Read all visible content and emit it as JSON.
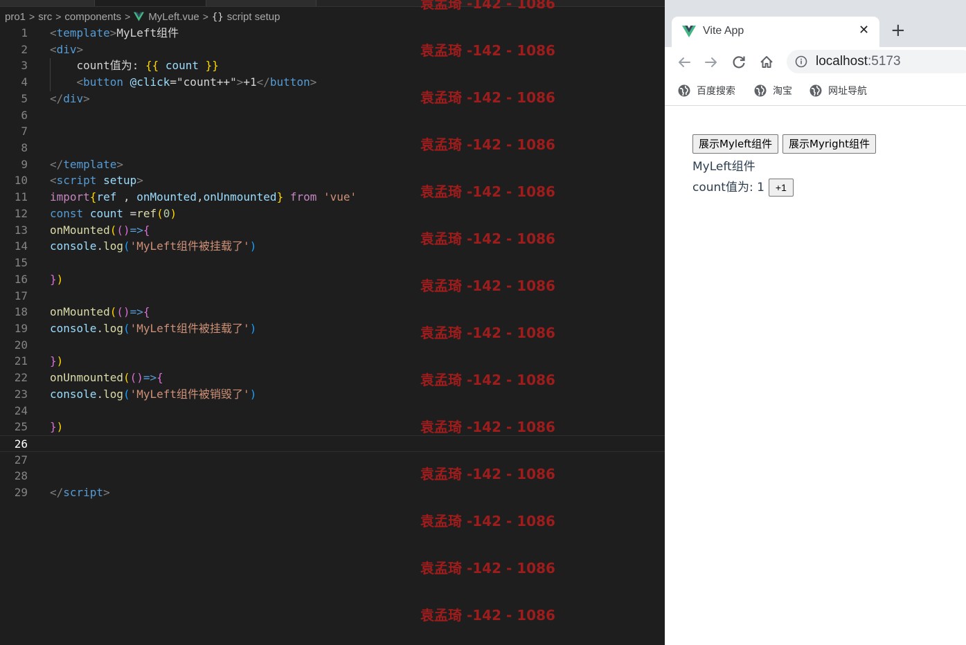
{
  "editor": {
    "breadcrumb": {
      "folder1": "pro1",
      "folder2": "src",
      "folder3": "components",
      "file": "MyLeft.vue",
      "symbol": "script setup"
    },
    "current_line": 26,
    "lines": [
      {
        "n": "1",
        "tokens": [
          [
            "t-punc",
            "<"
          ],
          [
            "t-tag",
            "template"
          ],
          [
            "t-punc",
            ">"
          ],
          [
            "t-text",
            "MyLeft组件"
          ]
        ]
      },
      {
        "n": "2",
        "tokens": [
          [
            "t-punc",
            "<"
          ],
          [
            "t-tag",
            "div"
          ],
          [
            "t-punc",
            ">"
          ]
        ]
      },
      {
        "n": "3",
        "tokens": [
          [
            "t-text",
            "    count值为: "
          ],
          [
            "t-br1",
            "{{"
          ],
          [
            "t-var",
            " count "
          ],
          [
            "t-br1",
            "}}"
          ]
        ]
      },
      {
        "n": "4",
        "tokens": [
          [
            "t-text",
            "    "
          ],
          [
            "t-punc",
            "<"
          ],
          [
            "t-tag",
            "button"
          ],
          [
            "t-text",
            " "
          ],
          [
            "t-attr",
            "@click"
          ],
          [
            "t-text",
            "=\"count++\""
          ],
          [
            "t-punc",
            ">"
          ],
          [
            "t-text",
            "+1"
          ],
          [
            "t-punc",
            "</"
          ],
          [
            "t-tag",
            "button"
          ],
          [
            "t-punc",
            ">"
          ]
        ]
      },
      {
        "n": "5",
        "tokens": [
          [
            "t-punc",
            "</"
          ],
          [
            "t-tag",
            "div"
          ],
          [
            "t-punc",
            ">"
          ]
        ]
      },
      {
        "n": "6",
        "tokens": []
      },
      {
        "n": "7",
        "tokens": []
      },
      {
        "n": "8",
        "tokens": []
      },
      {
        "n": "9",
        "tokens": [
          [
            "t-punc",
            "</"
          ],
          [
            "t-tag",
            "template"
          ],
          [
            "t-punc",
            ">"
          ]
        ]
      },
      {
        "n": "10",
        "tokens": [
          [
            "t-punc",
            "<"
          ],
          [
            "t-tag",
            "script"
          ],
          [
            "t-text",
            " "
          ],
          [
            "t-attr",
            "setup"
          ],
          [
            "t-punc",
            ">"
          ]
        ]
      },
      {
        "n": "11",
        "tokens": [
          [
            "t-kw",
            "import"
          ],
          [
            "t-br1",
            "{"
          ],
          [
            "t-var",
            "ref"
          ],
          [
            "t-text",
            " , "
          ],
          [
            "t-var",
            "onMounted"
          ],
          [
            "t-text",
            ","
          ],
          [
            "t-var",
            "onUnmounted"
          ],
          [
            "t-br1",
            "}"
          ],
          [
            "t-text",
            " "
          ],
          [
            "t-kw",
            "from"
          ],
          [
            "t-text",
            " "
          ],
          [
            "t-str",
            "'vue'"
          ]
        ]
      },
      {
        "n": "12",
        "tokens": [
          [
            "t-const",
            "const"
          ],
          [
            "t-text",
            " "
          ],
          [
            "t-var",
            "count"
          ],
          [
            "t-text",
            " ="
          ],
          [
            "t-fn",
            "ref"
          ],
          [
            "t-br1",
            "("
          ],
          [
            "t-num",
            "0"
          ],
          [
            "t-br1",
            ")"
          ]
        ]
      },
      {
        "n": "13",
        "tokens": [
          [
            "t-fn",
            "onMounted"
          ],
          [
            "t-br1",
            "("
          ],
          [
            "t-br2",
            "()"
          ],
          [
            "t-const",
            "=>"
          ],
          [
            "t-br2",
            "{"
          ]
        ]
      },
      {
        "n": "14",
        "tokens": [
          [
            "t-var",
            "console"
          ],
          [
            "t-text",
            "."
          ],
          [
            "t-fn",
            "log"
          ],
          [
            "t-br3",
            "("
          ],
          [
            "t-str",
            "'MyLeft组件被挂载了'"
          ],
          [
            "t-br3",
            ")"
          ]
        ]
      },
      {
        "n": "15",
        "tokens": []
      },
      {
        "n": "16",
        "tokens": [
          [
            "t-br2",
            "}"
          ],
          [
            "t-br1",
            ")"
          ]
        ]
      },
      {
        "n": "17",
        "tokens": []
      },
      {
        "n": "18",
        "tokens": [
          [
            "t-fn",
            "onMounted"
          ],
          [
            "t-br1",
            "("
          ],
          [
            "t-br2",
            "()"
          ],
          [
            "t-const",
            "=>"
          ],
          [
            "t-br2",
            "{"
          ]
        ]
      },
      {
        "n": "19",
        "tokens": [
          [
            "t-var",
            "console"
          ],
          [
            "t-text",
            "."
          ],
          [
            "t-fn",
            "log"
          ],
          [
            "t-br3",
            "("
          ],
          [
            "t-str",
            "'MyLeft组件被挂载了'"
          ],
          [
            "t-br3",
            ")"
          ]
        ]
      },
      {
        "n": "20",
        "tokens": []
      },
      {
        "n": "21",
        "tokens": [
          [
            "t-br2",
            "}"
          ],
          [
            "t-br1",
            ")"
          ]
        ]
      },
      {
        "n": "22",
        "tokens": [
          [
            "t-fn",
            "onUnmounted"
          ],
          [
            "t-br1",
            "("
          ],
          [
            "t-br2",
            "()"
          ],
          [
            "t-const",
            "=>"
          ],
          [
            "t-br2",
            "{"
          ]
        ]
      },
      {
        "n": "23",
        "tokens": [
          [
            "t-var",
            "console"
          ],
          [
            "t-text",
            "."
          ],
          [
            "t-fn",
            "log"
          ],
          [
            "t-br3",
            "("
          ],
          [
            "t-str",
            "'MyLeft组件被销毁了'"
          ],
          [
            "t-br3",
            ")"
          ]
        ]
      },
      {
        "n": "24",
        "tokens": []
      },
      {
        "n": "25",
        "tokens": [
          [
            "t-br2",
            "}"
          ],
          [
            "t-br1",
            ")"
          ]
        ]
      },
      {
        "n": "26",
        "tokens": []
      },
      {
        "n": "27",
        "tokens": []
      },
      {
        "n": "28",
        "tokens": []
      },
      {
        "n": "29",
        "tokens": [
          [
            "t-punc",
            "</"
          ],
          [
            "t-tag",
            "script"
          ],
          [
            "t-punc",
            ">"
          ]
        ]
      }
    ],
    "watermark": "袁孟琦 -142 - 1086"
  },
  "browser": {
    "tab_title": "Vite App",
    "close_label": "✕",
    "newtab_label": "+",
    "url_host": "localhost",
    "url_port": ":5173",
    "bookmarks": [
      "百度搜索",
      "淘宝",
      "网址导航"
    ],
    "page": {
      "button1": "展示Myleft组件",
      "button2": "展示Myright组件",
      "component_title": "MyLeft组件",
      "count_label": "count值为: 1",
      "plus_button": "+1"
    },
    "colors": {
      "vue_green": "#41b883",
      "vue_dark": "#35495e",
      "text": "#2c3e50"
    }
  }
}
